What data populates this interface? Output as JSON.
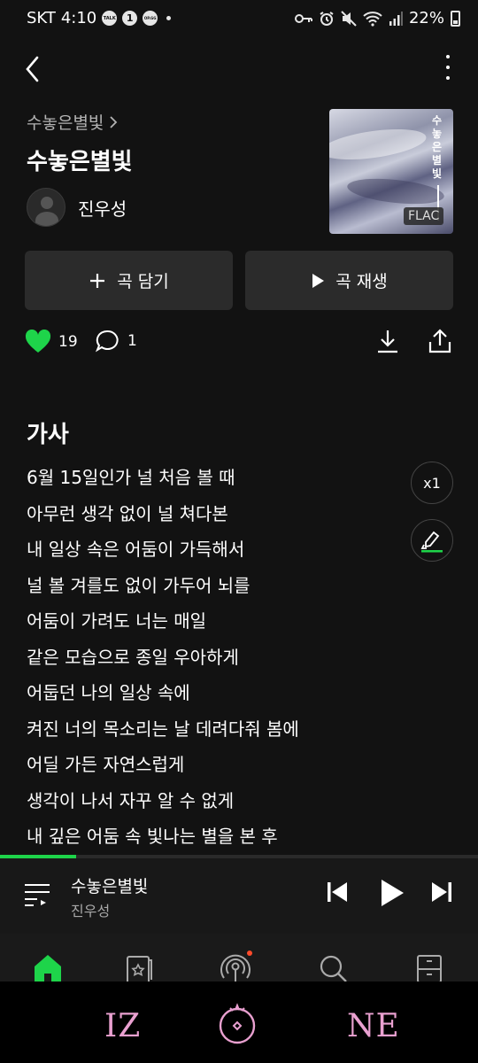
{
  "status_bar": {
    "carrier": "SKT",
    "time": "4:10",
    "battery": "22%",
    "badges": [
      "TALK",
      "1",
      "OP.GG"
    ]
  },
  "album_link": "수놓은별빛",
  "song_title": "수놓은별빛",
  "artist": "진우성",
  "cover": {
    "title_text": "수놓은별빛",
    "badge": "FLAC"
  },
  "buttons": {
    "add_label": "곡 담기",
    "play_label": "곡 재생"
  },
  "stats": {
    "likes": "19",
    "comments": "1"
  },
  "lyrics": {
    "heading": "가사",
    "lines": [
      "6월 15일인가 널 처음 볼 때",
      "아무런 생각 없이 널 쳐다본",
      "내 일상 속은 어둠이 가득해서",
      "널 볼 겨를도 없이 가두어 뇌를",
      "어둠이 가려도 너는 매일",
      "같은 모습으로 종일 우아하게",
      "어둡던 나의 일상 속에",
      "켜진 너의 목소리는 날 데려다줘 봄에",
      "어딜 가든 자연스럽게",
      "생각이 나서 자꾸 알 수 없게",
      "내 깊은 어둠 속 빛나는 별을 본 후"
    ],
    "speed_label": "x1"
  },
  "playback_progress": 0.16,
  "mini_player": {
    "title": "수놓은별빛",
    "artist": "진우성"
  },
  "tabs": [
    "home-icon",
    "library-icon",
    "podcast-icon",
    "search-icon",
    "storage-icon"
  ],
  "colors": {
    "accent": "#1ed44a",
    "background": "#121212",
    "button_bg": "#2b2b2b",
    "nav_pink": "#e9a0d0"
  },
  "nav_bar": {
    "left": "IZ",
    "right": "NE"
  }
}
